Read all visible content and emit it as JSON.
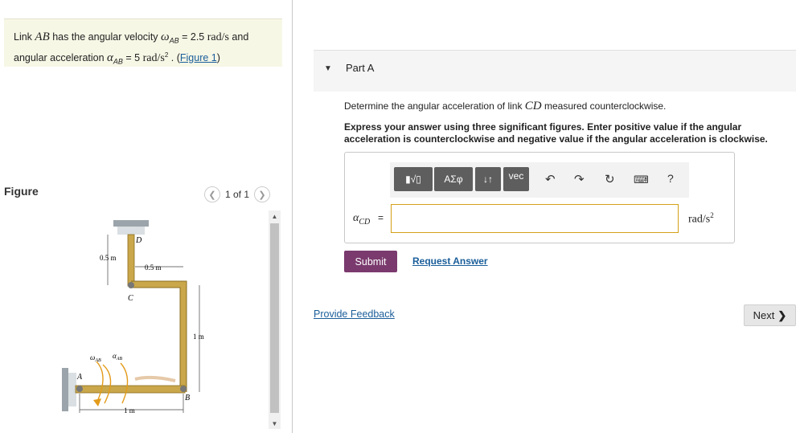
{
  "problem": {
    "text_link": "Link ",
    "var_ab": "AB",
    "text_has": " has the angular velocity ",
    "omega_symbol": "ω",
    "omega_sub": "AB",
    "omega_value": " = 2.5 ",
    "omega_unit": "rad/s",
    "text_and": " and",
    "text_accel": "angular acceleration ",
    "alpha_symbol": "α",
    "alpha_sub": "AB",
    "alpha_value": " = 5 ",
    "alpha_unit": "rad/s",
    "alpha_unit_sup": "2",
    "text_period": " . (",
    "figure_link": "Figure 1",
    "text_close": ")"
  },
  "figure": {
    "label": "Figure",
    "pager_text": "1 of 1",
    "prev_icon": "chevron-left-icon",
    "next_icon": "chevron-right-icon",
    "dims": {
      "d1": "0.5 m",
      "d2": "0.5 m",
      "d3": "1 m",
      "d4": "1 m"
    },
    "points": {
      "a": "A",
      "b": "B",
      "c": "C",
      "d": "D"
    },
    "omega_label": "ω",
    "omega_sub": "AB",
    "alpha_label": "α",
    "alpha_sub": "AB"
  },
  "part": {
    "title": "Part A",
    "question_prefix": "Determine the angular acceleration of link ",
    "question_var": "CD",
    "question_suffix": " measured counterclockwise.",
    "instructions": "Express your answer using three significant figures. Enter positive value if the angular acceleration is counterclockwise and negative value if the angular acceleration is clockwise.",
    "toolbar": {
      "templates": "▮√▯",
      "greek": "ΑΣφ",
      "arrows": "↓↑",
      "vec": "vec",
      "help": "?"
    },
    "answer": {
      "var_symbol": "α",
      "var_sub": "CD",
      "eq": "=",
      "value": "",
      "unit": "rad/s",
      "unit_sup": "2"
    },
    "submit_label": "Submit",
    "request_label": "Request Answer"
  },
  "footer": {
    "feedback_label": "Provide Feedback",
    "next_label": "Next"
  },
  "colors": {
    "submit_bg": "#7a3a6e",
    "link": "#1a5e9a",
    "figure_member": "#c9a74a",
    "input_border": "#d4a017"
  }
}
